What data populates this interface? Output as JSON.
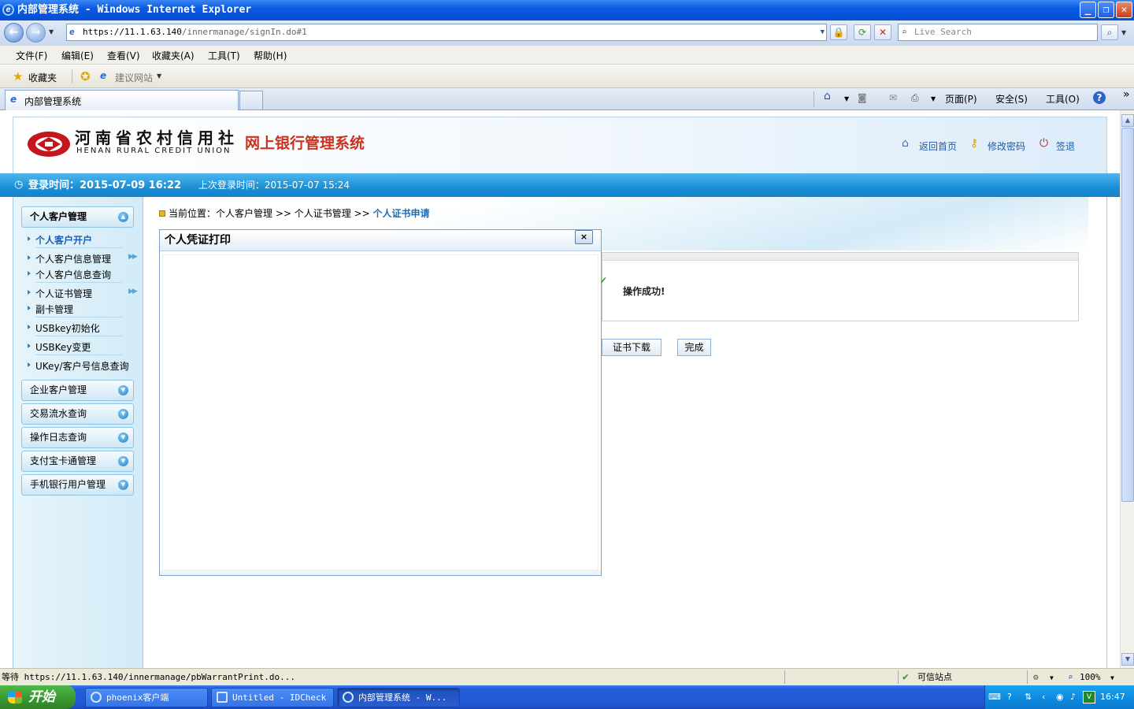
{
  "window": {
    "title": "内部管理系统 - Windows Internet Explorer"
  },
  "browser": {
    "url_host": "https://11.1.63.140",
    "url_path": "/innermanage/signIn.do#1",
    "search_placeholder": "Live Search",
    "menu": [
      "文件(F)",
      "编辑(E)",
      "查看(V)",
      "收藏夹(A)",
      "工具(T)",
      "帮助(H)"
    ],
    "favorites_label": "收藏夹",
    "suggested_sites": "建议网站",
    "tab_title": "内部管理系统",
    "cmd_page": "页面(P)",
    "cmd_safety": "安全(S)",
    "cmd_tools": "工具(O)",
    "status_text": "等待 https://11.1.63.140/innermanage/pbWarrantPrint.do...",
    "zone": "可信站点",
    "zoom": "100%"
  },
  "header": {
    "logo_cn": "河南省农村信用社",
    "logo_en": "HENAN RURAL CREDIT UNION",
    "system_title": "网上银行管理系统",
    "link_home": "返回首页",
    "link_password": "修改密码",
    "link_logout": "签退"
  },
  "login": {
    "current_label": "登录时间：2015-07-09 16:22",
    "last_label": "上次登录时间：2015-07-07 15:24"
  },
  "sidebar": {
    "section1": "个人客户管理",
    "items": [
      "个人客户开户",
      "个人客户信息管理",
      "个人客户信息查询",
      "个人证书管理",
      "副卡管理",
      "USBkey初始化",
      "USBKey变更",
      "UKey/客户号信息查询"
    ],
    "sections": [
      "企业客户管理",
      "交易流水查询",
      "操作日志查询",
      "支付宝卡通管理",
      "手机银行用户管理"
    ]
  },
  "main": {
    "crumb_prefix": "当前位置：个人客户管理 >> 个人证书管理 >> ",
    "crumb_current": "个人证书申请",
    "result_message": "操作成功!",
    "btn_download": "证书下载",
    "btn_finish": "完成"
  },
  "modal": {
    "title": "个人凭证打印",
    "close": "×"
  },
  "taskbar": {
    "start": "开始",
    "tasks": [
      "phoenix客户端",
      "Untitled - IDCheck",
      "内部管理系统 - W..."
    ],
    "clock": "16:47"
  }
}
